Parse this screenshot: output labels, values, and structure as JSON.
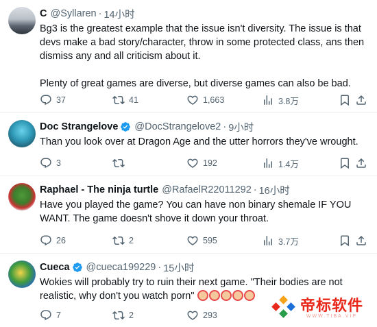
{
  "tweets": [
    {
      "name": "C",
      "handle": "@Syllaren",
      "dot": "·",
      "time": "14小时",
      "verified": false,
      "text": "Bg3 is the greatest example that the issue isn't diversity. The issue is that devs make a bad story/character, throw in some protected class, ans then dismiss any and all criticism about it.\n\nPlenty of great games are diverse, but diverse games can also be bad.",
      "replies": "37",
      "retweets": "41",
      "likes": "1,663",
      "views": "3.8万"
    },
    {
      "name": "Doc Strangelove",
      "handle": "@DocStrangelove2",
      "dot": "·",
      "time": "9小时",
      "verified": true,
      "text": "Than you look over at Dragon Age and the utter horrors they've wrought.",
      "replies": "3",
      "retweets": "",
      "likes": "192",
      "views": "1.4万"
    },
    {
      "name": "Raphael - The ninja turtle",
      "handle": "@RafaelR22011292",
      "dot": "·",
      "time": "16小时",
      "verified": false,
      "text": "Have you played the game? You can have non binary shemale IF YOU WANT. The game doesn't shove it down your throat.",
      "replies": "26",
      "retweets": "2",
      "likes": "595",
      "views": "3.7万"
    },
    {
      "name": "Cueca",
      "handle": "@cueca199229",
      "dot": "·",
      "time": "15小时",
      "verified": true,
      "text": "Wokies will probably try to ruin their next game. \"Their bodies are not realistic, why don't you watch porn\"",
      "replies": "7",
      "retweets": "2",
      "likes": "293",
      "views": ""
    }
  ],
  "watermark": {
    "brand": "帝标软件",
    "sub": "WWW.TIBA.VIP"
  },
  "colors": {
    "text": "#0f1419",
    "muted": "#536471",
    "verified": "#1d9bf0",
    "watermark": "#e8281b"
  }
}
